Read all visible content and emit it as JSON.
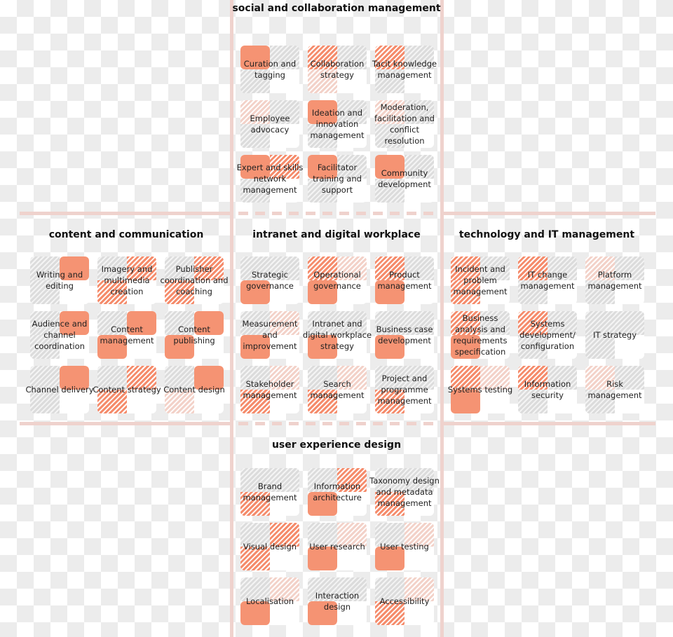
{
  "colors": {
    "solid": "#f48d6c",
    "hatched": "#f58c6c",
    "light_hatched": "#f3d2c9",
    "grey_hatched": "#dcdcdc",
    "lines": "#efd2cd"
  },
  "sections": [
    {
      "title": "social and collaboration management",
      "cells": [
        {
          "label": "Curation and tagging",
          "q": [
            "S",
            "G",
            "G"
          ]
        },
        {
          "label": "Collaboration strategy",
          "q": [
            "H",
            "G",
            "L"
          ]
        },
        {
          "label": "Tacit knowledge management",
          "q": [
            "H",
            "G",
            "G"
          ]
        },
        {
          "label": "Employee advocacy",
          "q": [
            "L",
            "G",
            "G"
          ]
        },
        {
          "label": "Ideation and innovation management",
          "q": [
            "S",
            "G",
            "G"
          ]
        },
        {
          "label": "Moderation, facilitation and conflict resolution",
          "q": [
            "L",
            "G",
            "G"
          ]
        },
        {
          "label": "Expert and skills network management",
          "q": [
            "S",
            "H",
            "G"
          ]
        },
        {
          "label": "Facilitator training and support",
          "q": [
            "S",
            "G",
            "G"
          ]
        },
        {
          "label": "Community development",
          "q": [
            "S",
            "G",
            "G"
          ]
        }
      ]
    },
    {
      "title": "content and communication",
      "cells": [
        {
          "label": "Writing and editing",
          "q": [
            "G",
            "S",
            "G"
          ]
        },
        {
          "label": "Imagery and multimedia creation",
          "q": [
            "G",
            "H",
            "H"
          ]
        },
        {
          "label": "Publisher coordination and coaching",
          "q": [
            "G",
            "H",
            "H"
          ]
        },
        {
          "label": "Audience and channel coordination",
          "q": [
            "G",
            "S",
            "G"
          ]
        },
        {
          "label": "Content management",
          "q": [
            "G",
            "S",
            "S"
          ]
        },
        {
          "label": "Content publishing",
          "q": [
            "G",
            "S",
            "S"
          ]
        },
        {
          "label": "Channel delivery",
          "q": [
            "G",
            "S",
            "G"
          ]
        },
        {
          "label": "Content strategy",
          "q": [
            "G",
            "H",
            "H"
          ]
        },
        {
          "label": "Content design",
          "q": [
            "G",
            "S",
            "L"
          ]
        }
      ]
    },
    {
      "title": "intranet and digital workplace",
      "cells": [
        {
          "label": "Strategic governance",
          "q": [
            "G",
            "G",
            "S"
          ]
        },
        {
          "label": "Operational governance",
          "q": [
            "H",
            "L",
            "S"
          ]
        },
        {
          "label": "Product management",
          "q": [
            "H",
            "G",
            "S"
          ]
        },
        {
          "label": "Measurement and improvement",
          "q": [
            "G",
            "L",
            "S"
          ]
        },
        {
          "label": "Intranet and digital workplace strategy",
          "q": [
            "G",
            "G",
            "S"
          ]
        },
        {
          "label": "Business case development",
          "q": [
            "G",
            "G",
            "S"
          ]
        },
        {
          "label": "Stakeholder management",
          "q": [
            "G",
            "L",
            "H"
          ]
        },
        {
          "label": "Search management",
          "q": [
            "G",
            "L",
            "H"
          ]
        },
        {
          "label": "Project and programme management",
          "q": [
            "G",
            "G",
            "H"
          ]
        }
      ]
    },
    {
      "title": "technology and IT management",
      "cells": [
        {
          "label": "Incident and problem management",
          "q": [
            "H",
            "G",
            "H"
          ]
        },
        {
          "label": "IT change management",
          "q": [
            "H",
            "G",
            "G"
          ]
        },
        {
          "label": "Platform management",
          "q": [
            "L",
            "G",
            "G"
          ]
        },
        {
          "label": "Business analysis and requirements specification",
          "q": [
            "H",
            "G",
            "S"
          ]
        },
        {
          "label": "Systems development/ configuration",
          "q": [
            "H",
            "G",
            "G"
          ]
        },
        {
          "label": "IT strategy",
          "q": [
            "G",
            "G",
            "G"
          ]
        },
        {
          "label": "Systems testing",
          "q": [
            "H",
            "L",
            "S"
          ]
        },
        {
          "label": "Information security",
          "q": [
            "H",
            "G",
            "G"
          ]
        },
        {
          "label": "Risk management",
          "q": [
            "L",
            "G",
            "G"
          ]
        }
      ]
    },
    {
      "title": "user experience design",
      "cells": [
        {
          "label": "Brand management",
          "q": [
            "G",
            "G",
            "H"
          ]
        },
        {
          "label": "Information architecture",
          "q": [
            "G",
            "H",
            "S"
          ]
        },
        {
          "label": "Taxonomy design and metadata management",
          "q": [
            "G",
            "G",
            "H"
          ]
        },
        {
          "label": "Visual design",
          "q": [
            "G",
            "H",
            "H"
          ]
        },
        {
          "label": "User research",
          "q": [
            "G",
            "L",
            "S"
          ]
        },
        {
          "label": "User testing",
          "q": [
            "G",
            "L",
            "S"
          ]
        },
        {
          "label": "Localisation",
          "q": [
            "G",
            "L",
            "S"
          ]
        },
        {
          "label": "Interaction design",
          "q": [
            "G",
            "G",
            "S"
          ]
        },
        {
          "label": "Accessibility",
          "q": [
            "G",
            "L",
            "H"
          ]
        }
      ]
    }
  ]
}
